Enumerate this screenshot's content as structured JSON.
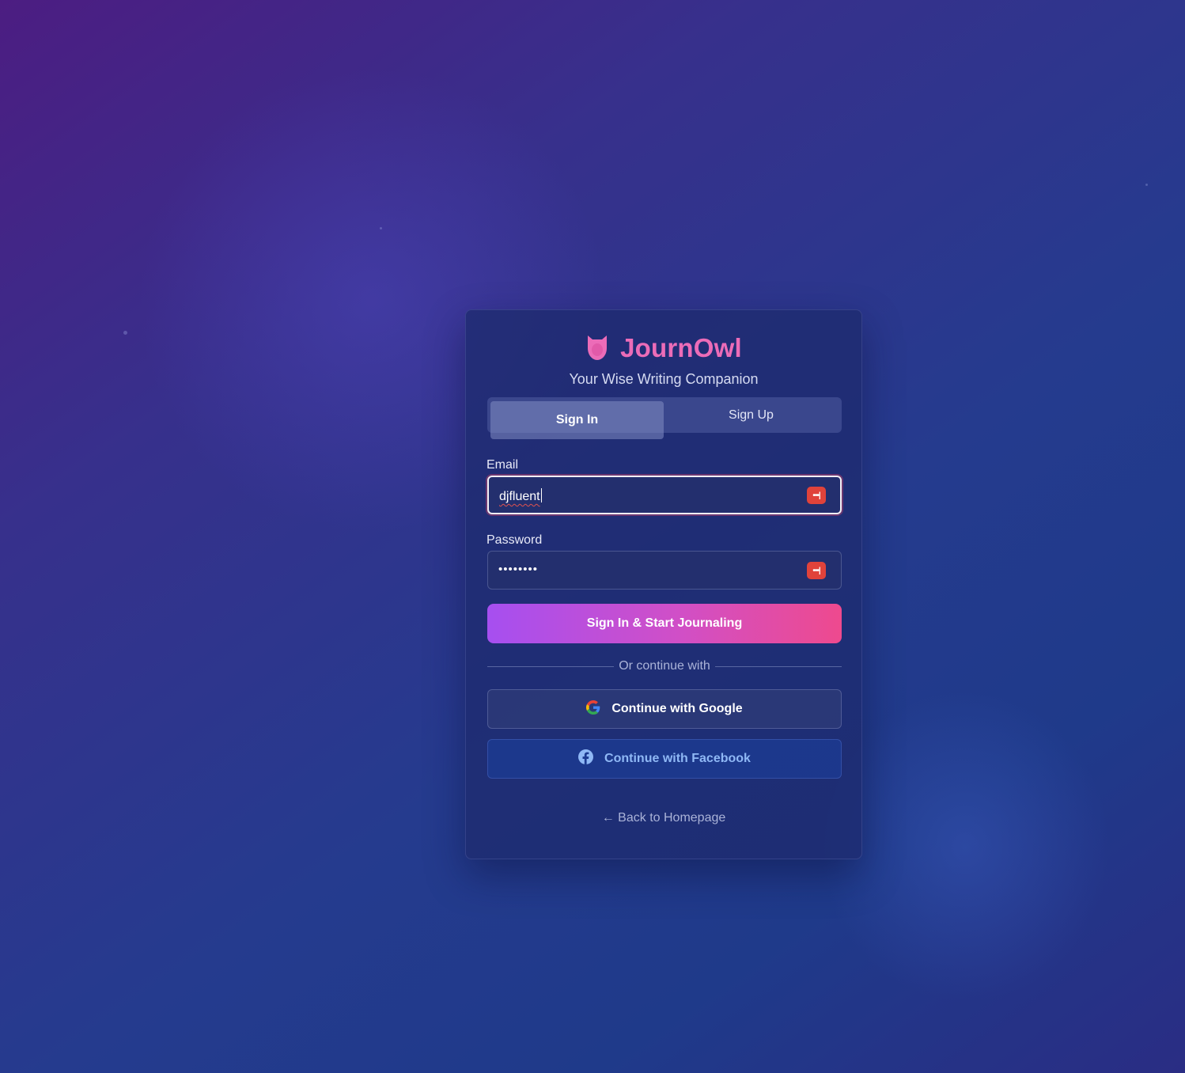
{
  "app": {
    "name": "JournOwl",
    "tagline": "Your Wise Writing Companion"
  },
  "tabs": [
    {
      "label": "Sign In",
      "active": true
    },
    {
      "label": "Sign Up",
      "active": false
    }
  ],
  "form": {
    "email_label": "Email",
    "email_value": "djfluent",
    "password_label": "Password",
    "password_value": "••••••••",
    "password_manager_badge": "•••|",
    "submit_label": "Sign In & Start Journaling"
  },
  "divider_text": "Or continue with",
  "social": {
    "google_label": "Continue with Google",
    "facebook_label": "Continue with Facebook"
  },
  "back_link": "← Back to Homepage",
  "colors": {
    "brand_pink": "#ec6cb8",
    "primary_gradient_start": "#a64ff0",
    "primary_gradient_end": "#ee4a8e",
    "password_manager_red": "#e0433b",
    "facebook_blue": "#8fb8f5"
  }
}
